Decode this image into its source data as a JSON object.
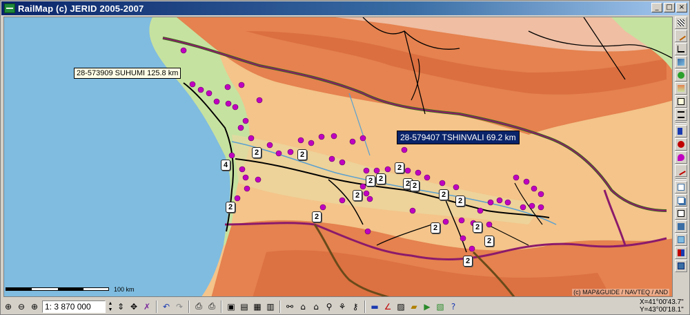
{
  "window": {
    "title": "RailMap (c) JERID 2005-2007",
    "controls": [
      "_",
      "□",
      "×"
    ]
  },
  "map": {
    "labels": {
      "suhumi": "28-573909 SUHUMI 125.8 km",
      "tshinvali": "28-579407 TSHINVALI  69.2 km"
    },
    "badges": [
      {
        "text": "2"
      },
      {
        "text": "2"
      },
      {
        "text": "4"
      },
      {
        "text": "2"
      },
      {
        "text": "2"
      },
      {
        "text": "2"
      },
      {
        "text": "2"
      },
      {
        "text": "2"
      },
      {
        "text": "2"
      },
      {
        "text": "2"
      },
      {
        "text": "2"
      },
      {
        "text": "2"
      },
      {
        "text": "2"
      },
      {
        "text": "2"
      },
      {
        "text": "2"
      },
      {
        "text": "2"
      },
      {
        "text": "2"
      }
    ],
    "copyright": "(c) MAP&GUIDE / NAVTEQ / AND",
    "scale_label": "100 km",
    "colors": {
      "sea": "#7fbce0",
      "lowland": "#c6e2a0",
      "hills": "#f4c48a",
      "mountains": "#e5824f",
      "border": "#8b1a6b",
      "rail": "#000000",
      "station": "#c000c0"
    }
  },
  "toolbar": {
    "scale_value": "1: 3 870 000",
    "coords_x": "X=41°00'43.7\"",
    "coords_y": "Y=43°00'18.1\""
  }
}
